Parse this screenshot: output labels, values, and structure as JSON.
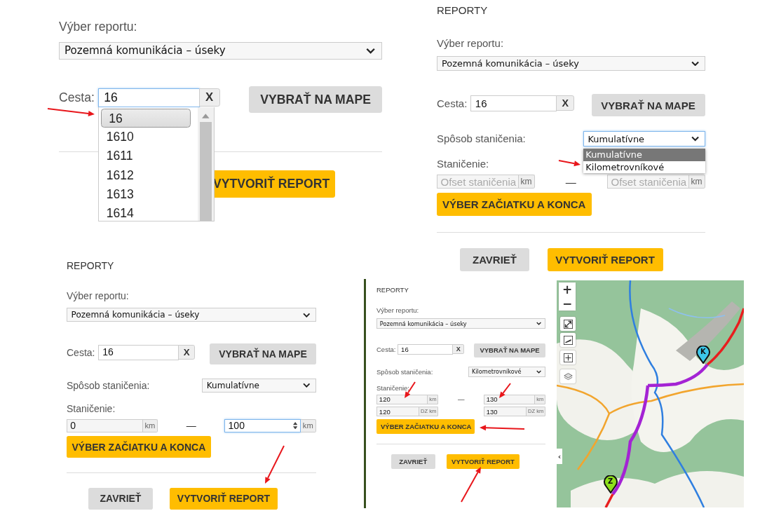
{
  "panels": [
    {
      "report_label": "Výber reportu:",
      "report_select": {
        "value": "Pozemná komunikácia – úseky",
        "focused": false
      },
      "road": {
        "label": "Cesta:",
        "value": "16",
        "focused": true,
        "clear_button": "X"
      },
      "map_button": "VYBRAŤ NA MAPE",
      "road_suggestions": [
        {
          "label": "16",
          "selected": true
        },
        {
          "label": "1610",
          "selected": false
        },
        {
          "label": "1611",
          "selected": false
        },
        {
          "label": "1612",
          "selected": false
        },
        {
          "label": "1613",
          "selected": false
        },
        {
          "label": "1614",
          "selected": false
        }
      ],
      "create_button": "VYTVORIŤ REPORT"
    },
    {
      "title": "REPORTY",
      "report_label": "Výber reportu:",
      "report_select": {
        "value": "Pozemná komunikácia – úseky",
        "focused": false
      },
      "road": {
        "label": "Cesta:",
        "value": "16",
        "focused": false,
        "clear_button": "X"
      },
      "map_button": "VYBRAŤ NA MAPE",
      "method": {
        "label": "Spôsob staničenia:",
        "value": "Kumulatívne",
        "focused": true,
        "options": [
          {
            "label": "Kumulatívne",
            "selected": true
          },
          {
            "label": "Kilometrovníkové",
            "selected": false
          }
        ]
      },
      "stationing": {
        "label": "Staničenie:",
        "dash": "—",
        "rows": [
          {
            "from": {
              "placeholder": "Ofset staničenia",
              "unit": "km",
              "focused": false
            },
            "to": {
              "placeholder": "Ofset staničenia",
              "unit": "km",
              "focused": false
            }
          }
        ]
      },
      "range_button": "VÝBER ZAČIATKU A KONCA",
      "close_button": "ZAVRIEŤ",
      "create_button": "VYTVORIŤ REPORT"
    },
    {
      "title": "REPORTY",
      "report_label": "Výber reportu:",
      "report_select": {
        "value": "Pozemná komunikácia – úseky",
        "focused": false
      },
      "road": {
        "label": "Cesta:",
        "value": "16",
        "focused": false,
        "clear_button": "X"
      },
      "map_button": "VYBRAŤ NA MAPE",
      "method": {
        "label": "Spôsob staničenia:",
        "value": "Kumulatívne",
        "focused": false
      },
      "stationing": {
        "label": "Staničenie:",
        "dash": "—",
        "rows": [
          {
            "from": {
              "value": "0",
              "unit": "km",
              "focused": false
            },
            "to": {
              "value": "100",
              "unit": "km",
              "focused": true
            }
          }
        ]
      },
      "range_button": "VÝBER ZAČIATKU A KONCA",
      "close_button": "ZAVRIEŤ",
      "create_button": "VYTVORIŤ REPORT"
    },
    {
      "title": "REPORTY",
      "report_label": "Výber reportu:",
      "report_select": {
        "value": "Pozemná komunikácia – úseky",
        "focused": false
      },
      "road": {
        "label": "Cesta:",
        "value": "16",
        "focused": false,
        "clear_button": "X"
      },
      "map_button": "VYBRAŤ NA MAPE",
      "method": {
        "label": "Spôsob staničenia:",
        "value": "Kilometrovníkové",
        "focused": false
      },
      "stationing": {
        "label": "Staničenie:",
        "dash": "—",
        "rows": [
          {
            "from": {
              "value": "120",
              "unit": "km",
              "focused": false
            },
            "to": {
              "value": "130",
              "unit": "km",
              "focused": false
            }
          },
          {
            "from": {
              "value": "120",
              "unit": "DZ km",
              "focused": false
            },
            "to": {
              "value": "130",
              "unit": "DZ km",
              "focused": false
            }
          }
        ]
      },
      "range_button": "VÝBER ZAČIATKU A KONCA",
      "close_button": "ZAVRIEŤ",
      "create_button": "VYTVORIŤ REPORT"
    }
  ],
  "map": {
    "kind": "picture",
    "zoom_in": "+",
    "zoom_out": "−",
    "collapse_tab": "‹",
    "markers": [
      {
        "label": "K",
        "color": "#3cc8ea"
      },
      {
        "label": "Z",
        "color": "#8ee01c"
      }
    ]
  }
}
